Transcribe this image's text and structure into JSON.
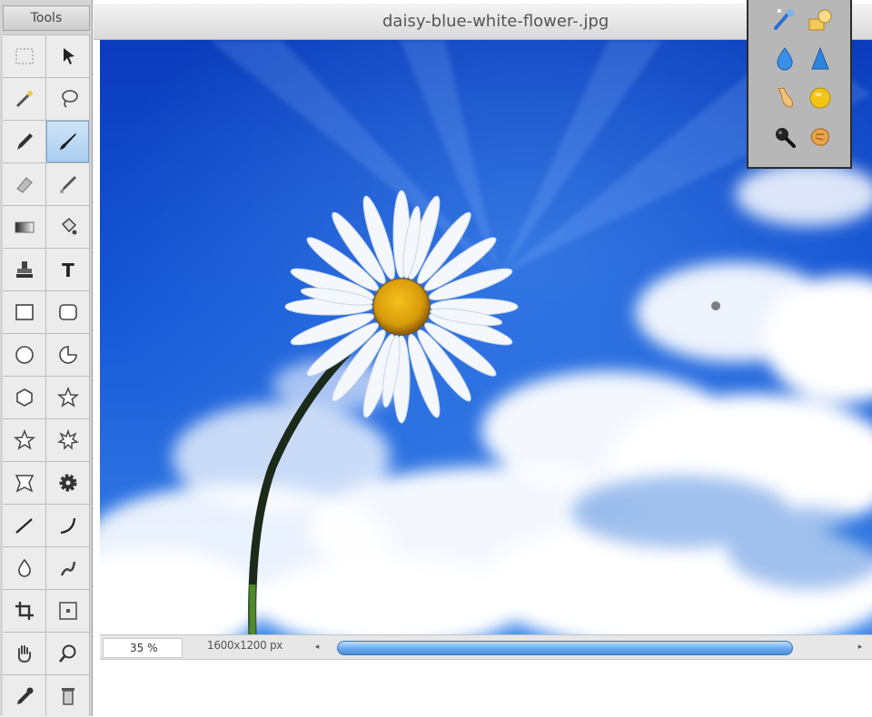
{
  "tools_panel": {
    "title": "Tools",
    "tools": [
      {
        "icon": "marquee-select-icon"
      },
      {
        "icon": "move-arrow-icon"
      },
      {
        "icon": "magic-wand-icon"
      },
      {
        "icon": "lasso-icon"
      },
      {
        "icon": "pencil-icon"
      },
      {
        "icon": "brush-icon",
        "active": true
      },
      {
        "icon": "eraser-icon"
      },
      {
        "icon": "smudge-icon"
      },
      {
        "icon": "gradient-icon"
      },
      {
        "icon": "paint-bucket-icon"
      },
      {
        "icon": "clone-stamp-icon"
      },
      {
        "icon": "text-icon"
      },
      {
        "icon": "rectangle-icon"
      },
      {
        "icon": "rounded-rectangle-icon"
      },
      {
        "icon": "ellipse-icon"
      },
      {
        "icon": "custom-shape-icon"
      },
      {
        "icon": "hexagon-icon"
      },
      {
        "icon": "star-icon"
      },
      {
        "icon": "star-outline-icon"
      },
      {
        "icon": "star-burst-icon"
      },
      {
        "icon": "badge-icon"
      },
      {
        "icon": "gear-shape-icon"
      },
      {
        "icon": "line-icon"
      },
      {
        "icon": "curve-icon"
      },
      {
        "icon": "drop-icon"
      },
      {
        "icon": "liquify-icon"
      },
      {
        "icon": "crop-icon"
      },
      {
        "icon": "transform-icon"
      },
      {
        "icon": "hand-icon"
      },
      {
        "icon": "zoom-icon"
      },
      {
        "icon": "eyedropper-icon"
      },
      {
        "icon": "trash-icon"
      }
    ]
  },
  "document": {
    "title": "daisy-blue-white-flower-.jpg"
  },
  "status_bar": {
    "zoom": "35 %",
    "dimensions": "1600x1200 px",
    "scroll_left_glyph": "◂",
    "scroll_right_glyph": "▸"
  },
  "extra_panel": {
    "tools": [
      {
        "icon": "magic-brush-icon"
      },
      {
        "icon": "shape-tool-icon"
      },
      {
        "icon": "blur-drop-icon"
      },
      {
        "icon": "sharpen-cone-icon"
      },
      {
        "icon": "smudge-finger-icon"
      },
      {
        "icon": "sponge-icon"
      },
      {
        "icon": "magnifier-icon"
      },
      {
        "icon": "color-replace-icon"
      }
    ]
  },
  "colors": {
    "panel_bg": "#d4d4d4",
    "tool_active": "#a9cdef",
    "scroll_thumb": "#6aa9ea",
    "sky_top": "#0a3fbf",
    "sky_mid": "#1f6fe0"
  }
}
